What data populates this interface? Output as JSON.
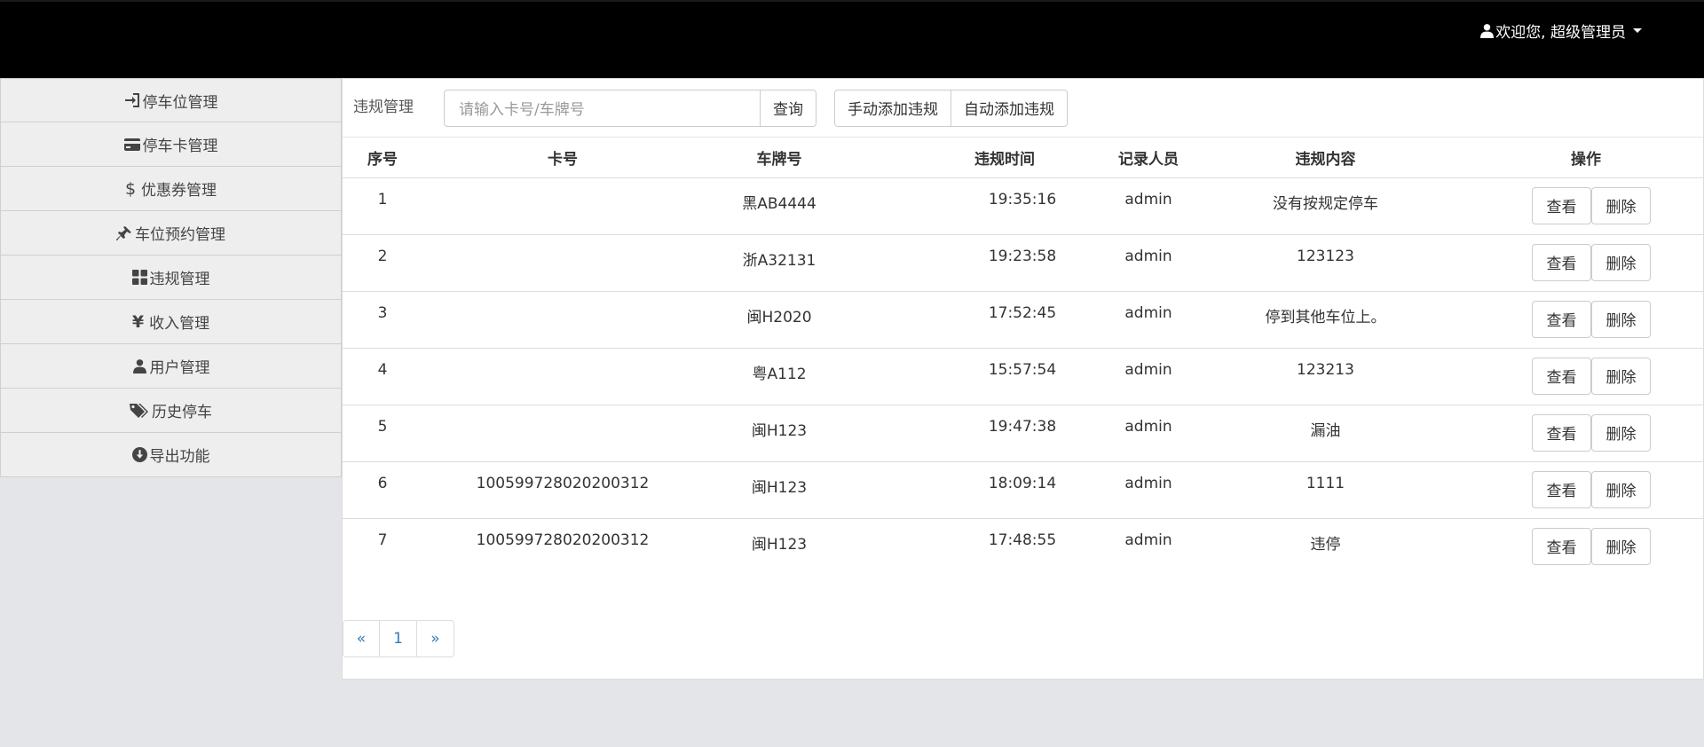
{
  "header": {
    "user_menu_label": "欢迎您, 超级管理员"
  },
  "sidebar": {
    "items": [
      {
        "label": "停车位管理",
        "icon": "login-icon"
      },
      {
        "label": "停车卡管理",
        "icon": "credit-card-icon"
      },
      {
        "label": "优惠券管理",
        "icon": "dollar-icon"
      },
      {
        "label": "车位预约管理",
        "icon": "pushpin-icon"
      },
      {
        "label": "违规管理",
        "icon": "grid-icon"
      },
      {
        "label": "收入管理",
        "icon": "yen-icon"
      },
      {
        "label": "用户管理",
        "icon": "user-icon"
      },
      {
        "label": "历史停车",
        "icon": "tags-icon"
      },
      {
        "label": "导出功能",
        "icon": "download-circle-icon"
      }
    ]
  },
  "toolbar": {
    "title": "违规管理",
    "search_placeholder": "请输入卡号/车牌号",
    "query_label": "查询",
    "manual_add_label": "手动添加违规",
    "auto_add_label": "自动添加违规"
  },
  "table": {
    "headers": [
      "序号",
      "卡号",
      "车牌号",
      "违规时间",
      "记录人员",
      "违规内容",
      "操作"
    ],
    "rows": [
      {
        "no": "1",
        "card": "",
        "plate": "黑AB4444",
        "time": "19:35:16",
        "recorder": "admin",
        "content": "没有按规定停车"
      },
      {
        "no": "2",
        "card": "",
        "plate": "浙A32131",
        "time": "19:23:58",
        "recorder": "admin",
        "content": "123123"
      },
      {
        "no": "3",
        "card": "",
        "plate": "闽H2020",
        "time": "17:52:45",
        "recorder": "admin",
        "content": "停到其他车位上。"
      },
      {
        "no": "4",
        "card": "",
        "plate": "粤A112",
        "time": "15:57:54",
        "recorder": "admin",
        "content": "123213"
      },
      {
        "no": "5",
        "card": "",
        "plate": "闽H123",
        "time": "19:47:38",
        "recorder": "admin",
        "content": "漏油"
      },
      {
        "no": "6",
        "card": "100599728020200312",
        "plate": "闽H123",
        "time": "18:09:14",
        "recorder": "admin",
        "content": "1111"
      },
      {
        "no": "7",
        "card": "100599728020200312",
        "plate": "闽H123",
        "time": "17:48:55",
        "recorder": "admin",
        "content": "违停"
      }
    ],
    "view_label": "查看",
    "delete_label": "删除"
  },
  "pagination": {
    "prev": "«",
    "pages": [
      "1"
    ],
    "next": "»"
  },
  "colors": {
    "header_bg": "#000000",
    "link": "#337ab7",
    "page_bg": "#e4e5e9"
  }
}
